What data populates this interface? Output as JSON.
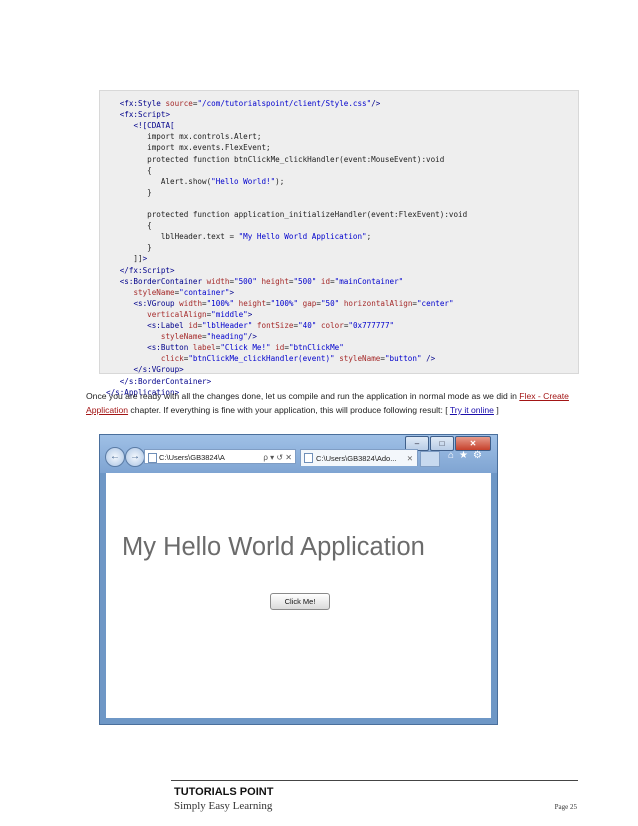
{
  "code": {
    "lines": [
      "   <fx:Style source=\"/com/tutorialspoint/client/Style.css\"/>",
      "   <fx:Script>",
      "      <![CDATA[",
      "         import mx.controls.Alert;",
      "         import mx.events.FlexEvent;",
      "         protected function btnClickMe_clickHandler(event:MouseEvent):void",
      "         {",
      "            Alert.show(\"Hello World!\");",
      "         }",
      "",
      "         protected function application_initializeHandler(event:FlexEvent):void",
      "         {",
      "            lblHeader.text = \"My Hello World Application\";",
      "         }",
      "      ]]>",
      "   </fx:Script>",
      "   <s:BorderContainer width=\"500\" height=\"500\" id=\"mainContainer\"",
      "      styleName=\"container\">",
      "      <s:VGroup width=\"100%\" height=\"100%\" gap=\"50\" horizontalAlign=\"center\"",
      "         verticalAlign=\"middle\">",
      "         <s:Label id=\"lblHeader\" fontSize=\"40\" color=\"0x777777\"",
      "            styleName=\"heading\"/>",
      "         <s:Button label=\"Click Me!\" id=\"btnClickMe\"",
      "            click=\"btnClickMe_clickHandler(event)\" styleName=\"button\" />",
      "      </s:VGroup>",
      "   </s:BorderContainer>",
      "</s:Application>"
    ]
  },
  "paragraph": {
    "part1": "Once you are ready with all the changes done, let us compile and run the application in normal mode as we did in ",
    "link": "Flex - Create Application",
    "part2": " chapter. If everything is fine with your application, this will produce following result: [ ",
    "try_link": "Try it online",
    "part3": " ]"
  },
  "browser": {
    "address": "C:\\Users\\GB3824\\A",
    "address_tools": "ρ ▾ ↺ ✕",
    "tab_label": "C:\\Users\\GB3824\\Ado...",
    "tab_close": "✕",
    "back_glyph": "←",
    "forward_glyph": "→",
    "minimize": "–",
    "maximize": "□",
    "close": "✕",
    "toolbar_icons": "⌂★⚙",
    "app_header": "My Hello World Application",
    "app_button": "Click Me!"
  },
  "footer": {
    "title": "TUTORIALS POINT",
    "subtitle": "Simply Easy Learning",
    "page": "Page 25"
  },
  "colors": {
    "code_bg": "#eeeeee",
    "tag": "#00008b",
    "attr": "#a52a2a",
    "value": "#0000cd",
    "link": "#a31515"
  }
}
